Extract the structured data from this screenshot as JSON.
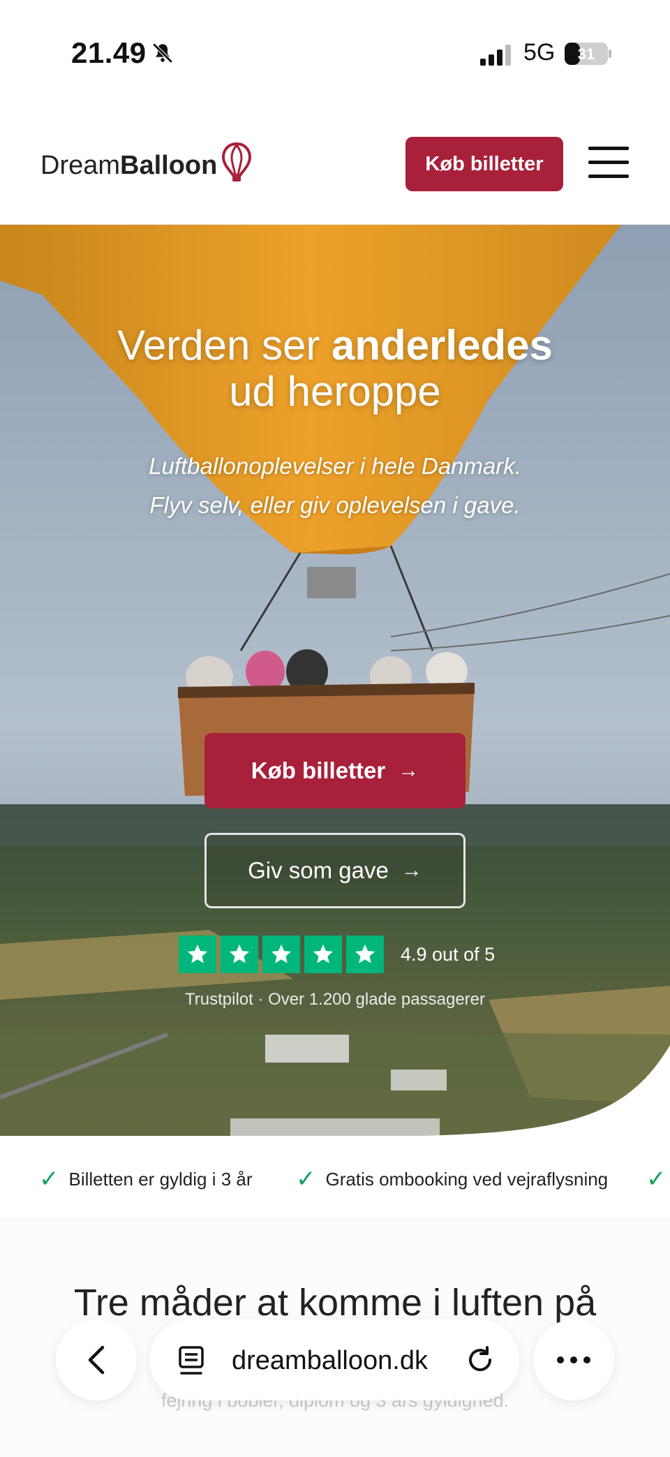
{
  "status_bar": {
    "time": "21.49",
    "network": "5G",
    "battery_level": "31"
  },
  "header": {
    "logo_light": "Dream",
    "logo_bold": "Balloon",
    "cta_label": "Køb billetter"
  },
  "hero": {
    "title_regular": "Verden ser ",
    "title_bold": "anderledes",
    "title_line2": "ud heroppe",
    "subtitle_line1": "Luftballonoplevelser i hele Danmark.",
    "subtitle_line2": "Flyv selv, eller giv oplevelsen i gave.",
    "primary_button": "Køb billetter",
    "secondary_button": "Giv som gave",
    "rating_text": "4.9 out of 5",
    "trust_line": "Trustpilot · Over 1.200 glade passagerer",
    "stars": 5
  },
  "benefits": [
    {
      "label": "Billetten er gyldig i 3 år"
    },
    {
      "label": "Gratis ombooking ved vejraflysning"
    },
    {
      "label": ""
    }
  ],
  "section": {
    "title": "Tre måder at komme i luften på",
    "faded_line": "fejring i bobler, diplom og 3 års gyldighed."
  },
  "browser": {
    "url": "dreamballoon.dk"
  },
  "colors": {
    "brand": "#a8203a",
    "trustpilot": "#00b67a",
    "check": "#16a05c"
  }
}
